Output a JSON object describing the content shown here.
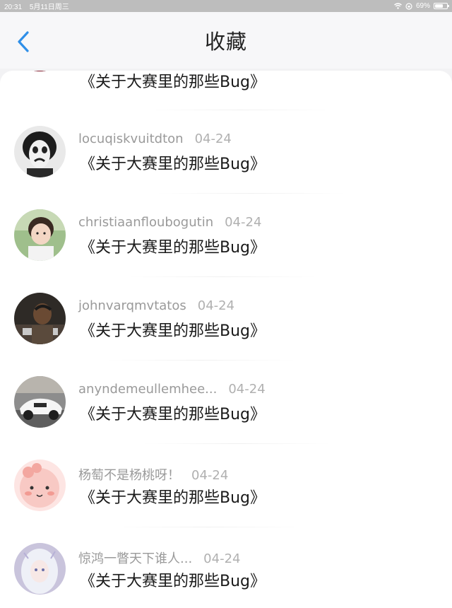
{
  "status_bar": {
    "time": "20:31",
    "date": "5月11日周三",
    "battery": "69%",
    "battery_level": 0.69
  },
  "nav": {
    "title": "收藏"
  },
  "items": [
    {
      "title": "《关于大赛里的那些Bug》"
    },
    {
      "author": "locuqiskvuitdton",
      "date": "04-24",
      "title": "《关于大赛里的那些Bug》"
    },
    {
      "author": "christiaanfloubogutin",
      "date": "04-24",
      "title": "《关于大赛里的那些Bug》"
    },
    {
      "author": "johnvarqmvtatos",
      "date": "04-24",
      "title": "《关于大赛里的那些Bug》"
    },
    {
      "author": "anyndemeullemhee...",
      "date": "04-24",
      "title": "《关于大赛里的那些Bug》"
    },
    {
      "author": "杨萄不是杨桃呀！",
      "date": "04-24",
      "title": "《关于大赛里的那些Bug》"
    },
    {
      "author": "惊鸿一瞥天下谁人...",
      "date": "04-24",
      "title": "《关于大赛里的那些Bug》"
    }
  ],
  "icons": {
    "back": "chevron-left-icon",
    "wifi": "wifi-icon",
    "lock": "orientation-lock-icon",
    "battery": "battery-icon"
  },
  "colors": {
    "accent": "#2f8fe8",
    "meta": "#9a9a9a"
  }
}
